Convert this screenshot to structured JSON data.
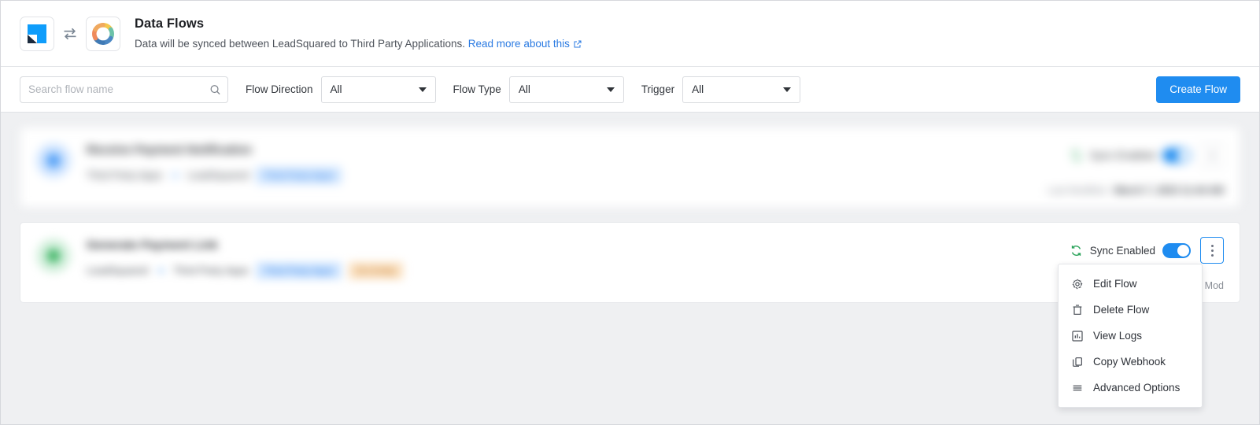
{
  "header": {
    "logo_left": "leadsquared-logo-icon",
    "logo_exchange": "exchange-arrows-icon",
    "logo_right": "third-party-swirl-icon",
    "title": "Data Flows",
    "subtitle": "Data will be synced between LeadSquared to Third Party Applications.",
    "link_text": "Read more about this",
    "link_icon": "external-link-icon"
  },
  "filters": {
    "search": {
      "placeholder": "Search flow name",
      "value": "",
      "icon": "search-icon"
    },
    "flow_direction": {
      "label": "Flow Direction",
      "value": "All"
    },
    "flow_type": {
      "label": "Flow Type",
      "value": "All"
    },
    "trigger": {
      "label": "Trigger",
      "value": "All"
    },
    "create_button": "Create Flow"
  },
  "flows": [
    {
      "title": "Receive Payment Notification",
      "source": "Third Party Apps",
      "target": "LeadSquared",
      "badges": [
        {
          "text": "Third Party Apps",
          "color": "blue"
        }
      ],
      "sync_label": "Sync Enabled",
      "sync_on": true,
      "last_modified_label": "Last Modified :",
      "last_modified_value": "March 7, 2023 11:44 AM",
      "avatar_color": "blue",
      "blurred": true
    },
    {
      "title": "Generate Payment Link",
      "source": "LeadSquared",
      "target": "Third Party Apps",
      "badges": [
        {
          "text": "Third Party Apps",
          "color": "blue"
        },
        {
          "text": "On Entity",
          "color": "orange"
        }
      ],
      "sync_label": "Sync Enabled",
      "sync_on": true,
      "last_modified_label": "Last Mod",
      "last_modified_value": "",
      "avatar_color": "green",
      "blurred": false
    }
  ],
  "context_menu": {
    "items": [
      {
        "label": "Edit Flow",
        "icon": "gear-icon"
      },
      {
        "label": "Delete Flow",
        "icon": "trash-icon"
      },
      {
        "label": "View Logs",
        "icon": "bar-chart-icon"
      },
      {
        "label": "Copy Webhook",
        "icon": "copy-icon"
      },
      {
        "label": "Advanced Options",
        "icon": "list-lines-icon"
      }
    ]
  },
  "colors": {
    "accent": "#1f8cf0",
    "link": "#2a7ae2",
    "success": "#2aa35a",
    "badge_blue_bg": "#cfe5ff",
    "badge_orange_bg": "#fae0c0",
    "page_bg": "#eff0f2"
  }
}
